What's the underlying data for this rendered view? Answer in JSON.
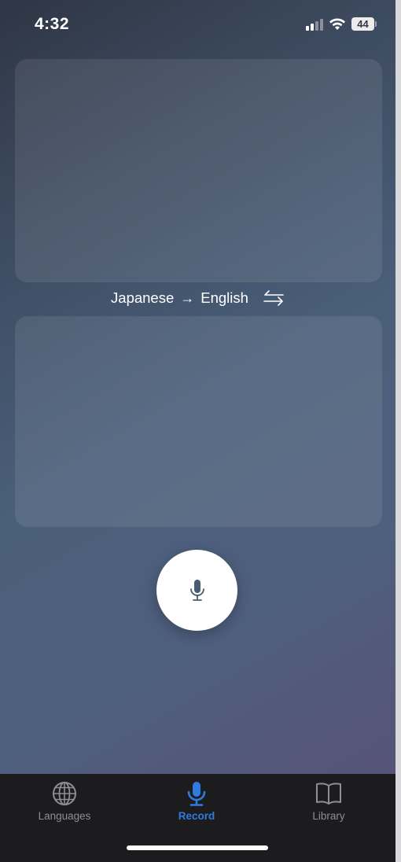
{
  "status_bar": {
    "time": "4:32",
    "battery": "44",
    "icons": [
      "signal-icon",
      "wifi-icon",
      "battery-icon"
    ]
  },
  "translator": {
    "source_text": "",
    "target_text": "",
    "source_language": "Japanese",
    "arrow": "→",
    "target_language": "English",
    "swap_icon": "swap-arrows-icon",
    "record_icon": "microphone-icon"
  },
  "tab_bar": {
    "tabs": [
      {
        "label": "Languages",
        "icon": "globe-icon",
        "active": false
      },
      {
        "label": "Record",
        "icon": "microphone-icon",
        "active": true
      },
      {
        "label": "Library",
        "icon": "book-icon",
        "active": false
      }
    ]
  },
  "colors": {
    "accent": "#2f7be0",
    "tab_inactive": "#8e8e93",
    "tab_bar_bg": "#1c1c1e",
    "mic_icon": "#4a5a72"
  }
}
